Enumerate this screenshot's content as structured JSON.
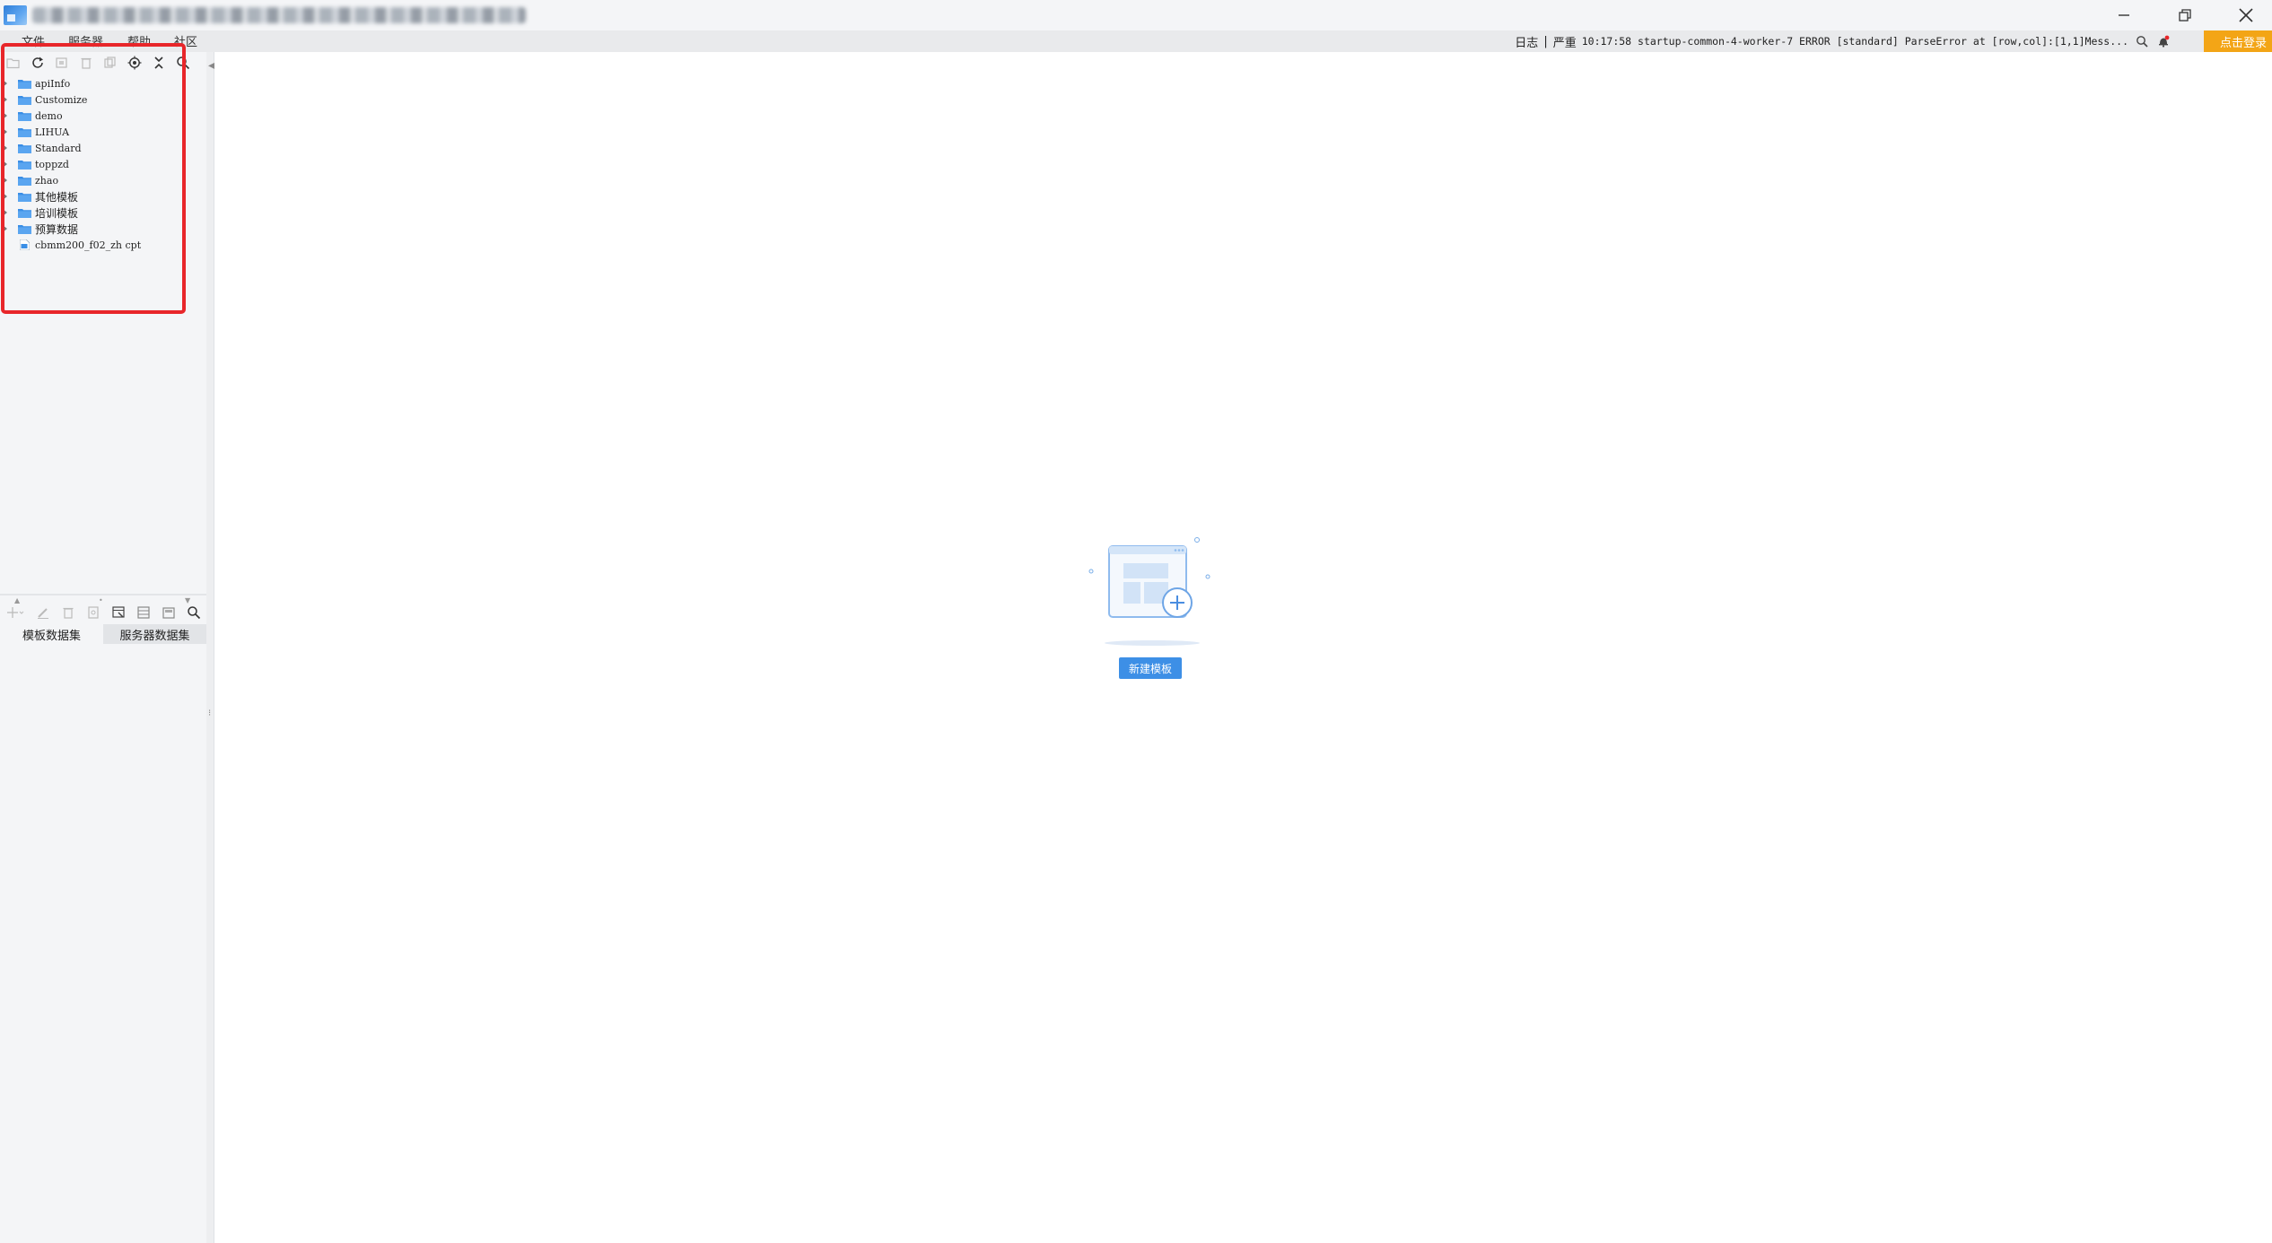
{
  "menubar": {
    "items": [
      "文件",
      "服务器",
      "帮助",
      "社区"
    ]
  },
  "log": {
    "label": "日志",
    "separator": "|",
    "severity": "严重",
    "message": "10:17:58 startup-common-4-worker-7 ERROR [standard] ParseError at [row,col]:[1,1]Mess..."
  },
  "login_button": "点击登录",
  "tree": {
    "items": [
      {
        "label": "apiInfo",
        "type": "folder"
      },
      {
        "label": "Customize",
        "type": "folder"
      },
      {
        "label": "demo",
        "type": "folder"
      },
      {
        "label": "LIHUA",
        "type": "folder"
      },
      {
        "label": "Standard",
        "type": "folder"
      },
      {
        "label": "toppzd",
        "type": "folder"
      },
      {
        "label": "zhao",
        "type": "folder"
      },
      {
        "label": "其他模板",
        "type": "folder"
      },
      {
        "label": "培训模板",
        "type": "folder"
      },
      {
        "label": "预算数据",
        "type": "folder"
      },
      {
        "label": "cbmm200_f02_zh cpt",
        "type": "file"
      }
    ]
  },
  "dataset_tabs": [
    "模板数据集",
    "服务器数据集"
  ],
  "main": {
    "new_template_button": "新建模板"
  },
  "colors": {
    "accent": "#3d8fe6",
    "folder": "#3a8ee6",
    "login": "#f3a516",
    "highlight": "#e8262a"
  }
}
